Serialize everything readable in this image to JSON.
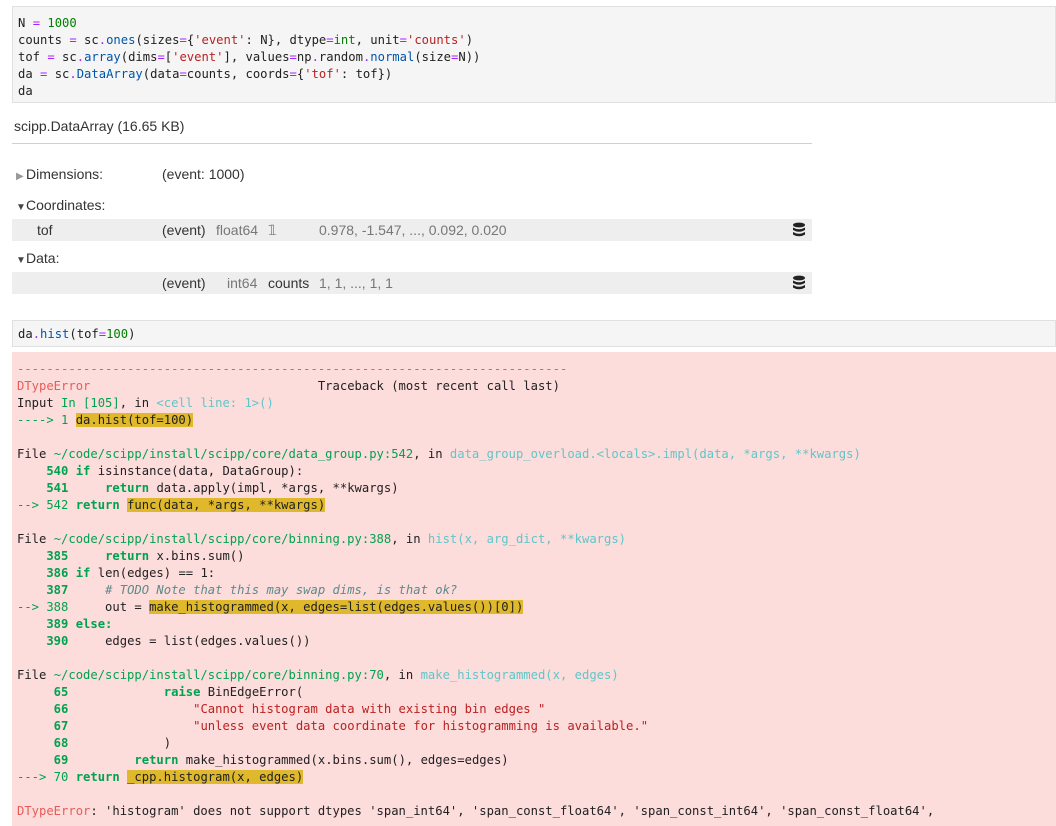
{
  "cell1_lines": [
    "N = 1000",
    "counts = sc.ones(sizes={'event': N}, dtype=int, unit='counts')",
    "tof = sc.array(dims=['event'], values=np.random.normal(size=N))",
    "da = sc.DataArray(data=counts, coords={'tof': tof})",
    "da"
  ],
  "repr": {
    "header": "scipp.DataArray (16.65 KB)",
    "dimensions_label": "Dimensions:",
    "dimensions_value": "(event: 1000)",
    "coordinates_label": "Coordinates:",
    "coord_name": "tof",
    "coord_dims": "(event)",
    "coord_dtype": "float64",
    "coord_unit": "𝟙",
    "coord_values": "0.978, -1.547, ..., 0.092, 0.020",
    "data_label": "Data:",
    "data_dims": "(event)",
    "data_dtype": "int64",
    "data_unit": "counts",
    "data_values": "1, 1, ..., 1, 1"
  },
  "cell2_code": "da.hist(tof=100)",
  "traceback": {
    "dashes": "---------------------------------------------------------------------------",
    "error_type": "DTypeError",
    "traceback_title": "Traceback (most recent call last)",
    "input_prefix": "Input ",
    "input_in": "In [105]",
    "input_mid": ", in ",
    "input_cell": "<cell line: 1>()",
    "arrow1": "----> 1 ",
    "line1_code": "da.hist(tof=100)",
    "file1_prefix": "File ",
    "file1_path": "~/code/scipp/install/scipp/core/data_group.py:542",
    "file1_in": ", in ",
    "file1_func": "data_group_overload.<locals>.impl(data, *args, **kwargs)",
    "f1_l540_no": "    540 ",
    "f1_l540": "isinstance(data, DataGroup):",
    "f1_l541_no": "    541 ",
    "f1_l541": "data.apply(impl, *args, **kwargs)",
    "f1_arrow": "--> 542 ",
    "f1_l542": "func(data, *args, **kwargs)",
    "file2_path": "~/code/scipp/install/scipp/core/binning.py:388",
    "file2_func": "hist(x, arg_dict, **kwargs)",
    "f2_l385_no": "    385 ",
    "f2_l385": "x.bins.sum()",
    "f2_l386_no": "    386 ",
    "f2_l386": "len(edges) == 1:",
    "f2_l387_no": "    387 ",
    "f2_l387": "# TODO Note that this may swap dims, is that ok?",
    "f2_arrow": "--> 388 ",
    "f2_l388_pre": "    out = ",
    "f2_l388": "make_histogrammed(x, edges=list(edges.values())[0])",
    "f2_l389_no": "    389 ",
    "f2_l390_no": "    390 ",
    "f2_l390": "edges = list(edges.values())",
    "file3_path": "~/code/scipp/install/scipp/core/binning.py:70",
    "file3_func": "make_histogrammed(x, edges)",
    "f3_l65_no": "     65 ",
    "f3_l65": "BinEdgeError(",
    "f3_l66_no": "     66 ",
    "f3_l66": "\"Cannot histogram data with existing bin edges \"",
    "f3_l67_no": "     67 ",
    "f3_l67": "\"unless event data coordinate for histogramming is available.\"",
    "f3_l68_no": "     68 ",
    "f3_l68": ")",
    "f3_l69_no": "     69 ",
    "f3_l69": "make_histogrammed(x.bins.sum(), edges=edges)",
    "f3_arrow": "---> 70 ",
    "f3_l70": "_cpp.histogram(x, edges)",
    "final_type": "DTypeError",
    "final_msg": ": 'histogram' does not support dtypes 'span_int64', 'span_const_float64', 'span_const_int64', 'span_const_float64',"
  },
  "keywords": {
    "if": "if",
    "return": "return",
    "else": "else:",
    "raise": "raise"
  },
  "icon_names": [
    "database-icon"
  ]
}
